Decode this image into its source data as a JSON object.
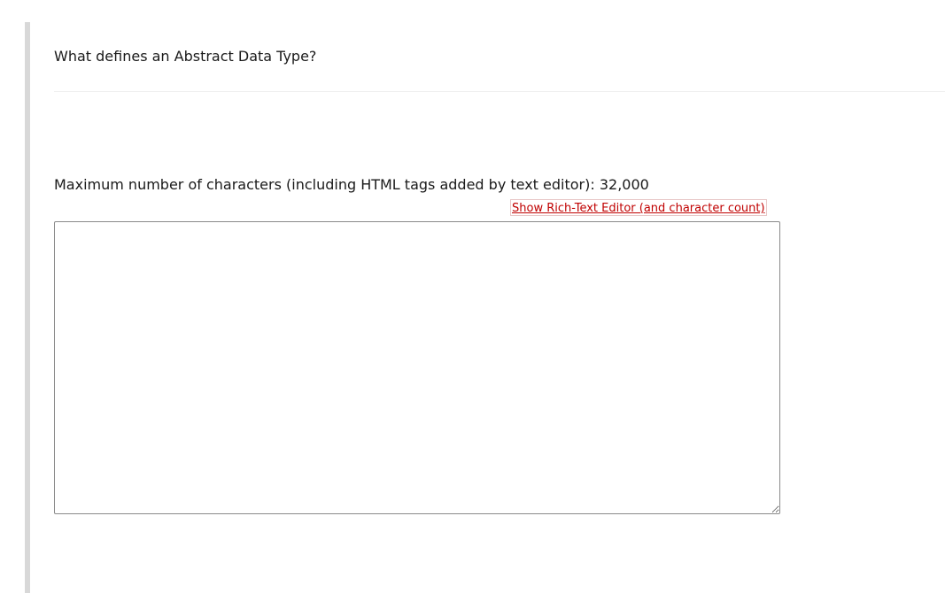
{
  "question": {
    "text": "What defines an Abstract Data Type?"
  },
  "answer": {
    "max_chars_label": "Maximum number of characters (including HTML tags added by text editor): 32,000",
    "rich_text_link": "Show Rich-Text Editor (and character count)",
    "value": "",
    "placeholder": ""
  },
  "colors": {
    "link": "#c00000",
    "left_bar": "#d8d8d8",
    "divider": "#eeeeee",
    "textarea_border": "#8a8a8a"
  }
}
